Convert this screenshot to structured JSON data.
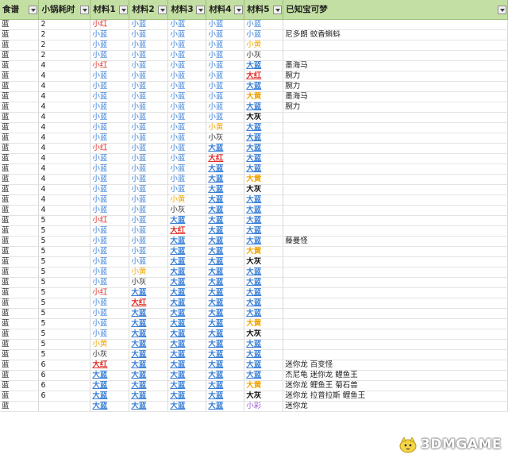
{
  "headers": [
    "食谱",
    "小锅耗时",
    "材料1",
    "材料2",
    "材料3",
    "材料4",
    "材料5",
    "已知宝可梦"
  ],
  "filtered_columns": [
    0,
    1,
    2,
    3,
    4,
    5,
    6,
    7
  ],
  "row_numbers": [
    "2",
    "3",
    "3",
    "3",
    "3",
    "8",
    "8",
    "9",
    "0",
    "1",
    "3",
    "7",
    "7",
    "8",
    "9",
    "0",
    "3",
    "4",
    "2",
    "4",
    "6",
    "2",
    "2",
    "8",
    "2",
    "0",
    "3",
    "4",
    "8",
    "2",
    "3",
    "2",
    "3",
    "4",
    "5",
    "8",
    "3",
    "8",
    "2",
    "4",
    "5",
    "5"
  ],
  "rows": [
    {
      "recipe": "蓝",
      "time": "2",
      "m1": "小红",
      "m1c": "red",
      "m2": "小蓝",
      "m2c": "blue",
      "m3": "小蓝",
      "m3c": "blue",
      "m4": "小蓝",
      "m4c": "blue",
      "m5": "小蓝",
      "m5c": "blue",
      "mons": ""
    },
    {
      "recipe": "蓝",
      "time": "2",
      "m1": "小蓝",
      "m1c": "blue",
      "m2": "小蓝",
      "m2c": "blue",
      "m3": "小蓝",
      "m3c": "blue",
      "m4": "小蓝",
      "m4c": "blue",
      "m5": "小蓝",
      "m5c": "blue",
      "mons": "尼多朗 蚊香蝌蚪"
    },
    {
      "recipe": "蓝",
      "time": "2",
      "m1": "小蓝",
      "m1c": "blue",
      "m2": "小蓝",
      "m2c": "blue",
      "m3": "小蓝",
      "m3c": "blue",
      "m4": "小蓝",
      "m4c": "blue",
      "m5": "小黄",
      "m5c": "yellow",
      "mons": ""
    },
    {
      "recipe": "蓝",
      "time": "2",
      "m1": "小蓝",
      "m1c": "blue",
      "m2": "小蓝",
      "m2c": "blue",
      "m3": "小蓝",
      "m3c": "blue",
      "m4": "小蓝",
      "m4c": "blue",
      "m5": "小灰",
      "m5c": "gray",
      "mons": ""
    },
    {
      "recipe": "蓝",
      "time": "4",
      "m1": "小红",
      "m1c": "red",
      "m2": "小蓝",
      "m2c": "blue",
      "m3": "小蓝",
      "m3c": "blue",
      "m4": "小蓝",
      "m4c": "blue",
      "m5": "大蓝",
      "m5c": "blue",
      "m5b": true,
      "mons": "墨海马"
    },
    {
      "recipe": "蓝",
      "time": "4",
      "m1": "小蓝",
      "m1c": "blue",
      "m2": "小蓝",
      "m2c": "blue",
      "m3": "小蓝",
      "m3c": "blue",
      "m4": "小蓝",
      "m4c": "blue",
      "m5": "大红",
      "m5c": "red",
      "m5b": true,
      "mons": "腕力"
    },
    {
      "recipe": "蓝",
      "time": "4",
      "m1": "小蓝",
      "m1c": "blue",
      "m2": "小蓝",
      "m2c": "blue",
      "m3": "小蓝",
      "m3c": "blue",
      "m4": "小蓝",
      "m4c": "blue",
      "m5": "大蓝",
      "m5c": "blue",
      "m5b": true,
      "mons": "腕力"
    },
    {
      "recipe": "蓝",
      "time": "4",
      "m1": "小蓝",
      "m1c": "blue",
      "m2": "小蓝",
      "m2c": "blue",
      "m3": "小蓝",
      "m3c": "blue",
      "m4": "小蓝",
      "m4c": "blue",
      "m5": "大黄",
      "m5c": "yellow",
      "m5b": true,
      "mons": "墨海马"
    },
    {
      "recipe": "蓝",
      "time": "4",
      "m1": "小蓝",
      "m1c": "blue",
      "m2": "小蓝",
      "m2c": "blue",
      "m3": "小蓝",
      "m3c": "blue",
      "m4": "小蓝",
      "m4c": "blue",
      "m5": "大蓝",
      "m5c": "blue",
      "m5b": true,
      "mons": "腕力"
    },
    {
      "recipe": "蓝",
      "time": "4",
      "m1": "小蓝",
      "m1c": "blue",
      "m2": "小蓝",
      "m2c": "blue",
      "m3": "小蓝",
      "m3c": "blue",
      "m4": "小蓝",
      "m4c": "blue",
      "m5": "大灰",
      "m5c": "gray",
      "m5b": true,
      "mons": ""
    },
    {
      "recipe": "蓝",
      "time": "4",
      "m1": "小蓝",
      "m1c": "blue",
      "m2": "小蓝",
      "m2c": "blue",
      "m3": "小蓝",
      "m3c": "blue",
      "m4": "小黄",
      "m4c": "yellow",
      "m5": "大蓝",
      "m5c": "blue",
      "m5b": true,
      "mons": ""
    },
    {
      "recipe": "蓝",
      "time": "4",
      "m1": "小蓝",
      "m1c": "blue",
      "m2": "小蓝",
      "m2c": "blue",
      "m3": "小蓝",
      "m3c": "blue",
      "m4": "小灰",
      "m4c": "gray",
      "m5": "大蓝",
      "m5c": "blue",
      "m5b": true,
      "mons": ""
    },
    {
      "recipe": "蓝",
      "time": "4",
      "m1": "小红",
      "m1c": "red",
      "m2": "小蓝",
      "m2c": "blue",
      "m3": "小蓝",
      "m3c": "blue",
      "m4": "大蓝",
      "m4c": "blue",
      "m4b": true,
      "m5": "大蓝",
      "m5c": "blue",
      "m5b": true,
      "mons": ""
    },
    {
      "recipe": "蓝",
      "time": "4",
      "m1": "小蓝",
      "m1c": "blue",
      "m2": "小蓝",
      "m2c": "blue",
      "m3": "小蓝",
      "m3c": "blue",
      "m4": "大红",
      "m4c": "red",
      "m4b": true,
      "m5": "大蓝",
      "m5c": "blue",
      "m5b": true,
      "mons": ""
    },
    {
      "recipe": "蓝",
      "time": "4",
      "m1": "小蓝",
      "m1c": "blue",
      "m2": "小蓝",
      "m2c": "blue",
      "m3": "小蓝",
      "m3c": "blue",
      "m4": "大蓝",
      "m4c": "blue",
      "m4b": true,
      "m5": "大蓝",
      "m5c": "blue",
      "m5b": true,
      "mons": ""
    },
    {
      "recipe": "蓝",
      "time": "4",
      "m1": "小蓝",
      "m1c": "blue",
      "m2": "小蓝",
      "m2c": "blue",
      "m3": "小蓝",
      "m3c": "blue",
      "m4": "大蓝",
      "m4c": "blue",
      "m4b": true,
      "m5": "大黄",
      "m5c": "yellow",
      "m5b": true,
      "mons": ""
    },
    {
      "recipe": "蓝",
      "time": "4",
      "m1": "小蓝",
      "m1c": "blue",
      "m2": "小蓝",
      "m2c": "blue",
      "m3": "小蓝",
      "m3c": "blue",
      "m4": "大蓝",
      "m4c": "blue",
      "m4b": true,
      "m5": "大灰",
      "m5c": "gray",
      "m5b": true,
      "mons": ""
    },
    {
      "recipe": "蓝",
      "time": "4",
      "m1": "小蓝",
      "m1c": "blue",
      "m2": "小蓝",
      "m2c": "blue",
      "m3": "小黄",
      "m3c": "yellow",
      "m4": "大蓝",
      "m4c": "blue",
      "m4b": true,
      "m5": "大蓝",
      "m5c": "blue",
      "m5b": true,
      "mons": ""
    },
    {
      "recipe": "蓝",
      "time": "4",
      "m1": "小蓝",
      "m1c": "blue",
      "m2": "小蓝",
      "m2c": "blue",
      "m3": "小灰",
      "m3c": "gray",
      "m4": "大蓝",
      "m4c": "blue",
      "m4b": true,
      "m5": "大蓝",
      "m5c": "blue",
      "m5b": true,
      "mons": ""
    },
    {
      "recipe": "蓝",
      "time": "5",
      "m1": "小红",
      "m1c": "red",
      "m2": "小蓝",
      "m2c": "blue",
      "m3": "大蓝",
      "m3c": "blue",
      "m3b": true,
      "m4": "大蓝",
      "m4c": "blue",
      "m4b": true,
      "m5": "大蓝",
      "m5c": "blue",
      "m5b": true,
      "mons": ""
    },
    {
      "recipe": "蓝",
      "time": "5",
      "m1": "小蓝",
      "m1c": "blue",
      "m2": "小蓝",
      "m2c": "blue",
      "m3": "大红",
      "m3c": "red",
      "m3b": true,
      "m4": "大蓝",
      "m4c": "blue",
      "m4b": true,
      "m5": "大蓝",
      "m5c": "blue",
      "m5b": true,
      "mons": ""
    },
    {
      "recipe": "蓝",
      "time": "5",
      "m1": "小蓝",
      "m1c": "blue",
      "m2": "小蓝",
      "m2c": "blue",
      "m3": "大蓝",
      "m3c": "blue",
      "m3b": true,
      "m4": "大蓝",
      "m4c": "blue",
      "m4b": true,
      "m5": "大蓝",
      "m5c": "blue",
      "m5b": true,
      "mons": "藤曼怪"
    },
    {
      "recipe": "蓝",
      "time": "5",
      "m1": "小蓝",
      "m1c": "blue",
      "m2": "小蓝",
      "m2c": "blue",
      "m3": "大蓝",
      "m3c": "blue",
      "m3b": true,
      "m4": "大蓝",
      "m4c": "blue",
      "m4b": true,
      "m5": "大黄",
      "m5c": "yellow",
      "m5b": true,
      "mons": ""
    },
    {
      "recipe": "蓝",
      "time": "5",
      "m1": "小蓝",
      "m1c": "blue",
      "m2": "小蓝",
      "m2c": "blue",
      "m3": "大蓝",
      "m3c": "blue",
      "m3b": true,
      "m4": "大蓝",
      "m4c": "blue",
      "m4b": true,
      "m5": "大灰",
      "m5c": "gray",
      "m5b": true,
      "mons": ""
    },
    {
      "recipe": "蓝",
      "time": "5",
      "m1": "小蓝",
      "m1c": "blue",
      "m2": "小黄",
      "m2c": "yellow",
      "m3": "大蓝",
      "m3c": "blue",
      "m3b": true,
      "m4": "大蓝",
      "m4c": "blue",
      "m4b": true,
      "m5": "大蓝",
      "m5c": "blue",
      "m5b": true,
      "mons": ""
    },
    {
      "recipe": "蓝",
      "time": "5",
      "m1": "小蓝",
      "m1c": "blue",
      "m2": "小灰",
      "m2c": "gray",
      "m3": "大蓝",
      "m3c": "blue",
      "m3b": true,
      "m4": "大蓝",
      "m4c": "blue",
      "m4b": true,
      "m5": "大蓝",
      "m5c": "blue",
      "m5b": true,
      "mons": ""
    },
    {
      "recipe": "蓝",
      "time": "5",
      "m1": "小红",
      "m1c": "red",
      "m2": "大蓝",
      "m2c": "blue",
      "m2b": true,
      "m3": "大蓝",
      "m3c": "blue",
      "m3b": true,
      "m4": "大蓝",
      "m4c": "blue",
      "m4b": true,
      "m5": "大蓝",
      "m5c": "blue",
      "m5b": true,
      "mons": ""
    },
    {
      "recipe": "蓝",
      "time": "5",
      "m1": "小蓝",
      "m1c": "blue",
      "m2": "大红",
      "m2c": "red",
      "m2b": true,
      "m3": "大蓝",
      "m3c": "blue",
      "m3b": true,
      "m4": "大蓝",
      "m4c": "blue",
      "m4b": true,
      "m5": "大蓝",
      "m5c": "blue",
      "m5b": true,
      "mons": ""
    },
    {
      "recipe": "蓝",
      "time": "5",
      "m1": "小蓝",
      "m1c": "blue",
      "m2": "大蓝",
      "m2c": "blue",
      "m2b": true,
      "m3": "大蓝",
      "m3c": "blue",
      "m3b": true,
      "m4": "大蓝",
      "m4c": "blue",
      "m4b": true,
      "m5": "大蓝",
      "m5c": "blue",
      "m5b": true,
      "mons": ""
    },
    {
      "recipe": "蓝",
      "time": "5",
      "m1": "小蓝",
      "m1c": "blue",
      "m2": "大蓝",
      "m2c": "blue",
      "m2b": true,
      "m3": "大蓝",
      "m3c": "blue",
      "m3b": true,
      "m4": "大蓝",
      "m4c": "blue",
      "m4b": true,
      "m5": "大黄",
      "m5c": "yellow",
      "m5b": true,
      "mons": ""
    },
    {
      "recipe": "蓝",
      "time": "5",
      "m1": "小蓝",
      "m1c": "blue",
      "m2": "大蓝",
      "m2c": "blue",
      "m2b": true,
      "m3": "大蓝",
      "m3c": "blue",
      "m3b": true,
      "m4": "大蓝",
      "m4c": "blue",
      "m4b": true,
      "m5": "大灰",
      "m5c": "gray",
      "m5b": true,
      "mons": ""
    },
    {
      "recipe": "蓝",
      "time": "5",
      "m1": "小黄",
      "m1c": "yellow",
      "m2": "大蓝",
      "m2c": "blue",
      "m2b": true,
      "m3": "大蓝",
      "m3c": "blue",
      "m3b": true,
      "m4": "大蓝",
      "m4c": "blue",
      "m4b": true,
      "m5": "大蓝",
      "m5c": "blue",
      "m5b": true,
      "mons": ""
    },
    {
      "recipe": "蓝",
      "time": "5",
      "m1": "小灰",
      "m1c": "gray",
      "m2": "大蓝",
      "m2c": "blue",
      "m2b": true,
      "m3": "大蓝",
      "m3c": "blue",
      "m3b": true,
      "m4": "大蓝",
      "m4c": "blue",
      "m4b": true,
      "m5": "大蓝",
      "m5c": "blue",
      "m5b": true,
      "mons": ""
    },
    {
      "recipe": "蓝",
      "time": "6",
      "m1": "大红",
      "m1c": "red",
      "m1b": true,
      "m2": "大蓝",
      "m2c": "blue",
      "m2b": true,
      "m3": "大蓝",
      "m3c": "blue",
      "m3b": true,
      "m4": "大蓝",
      "m4c": "blue",
      "m4b": true,
      "m5": "大蓝",
      "m5c": "blue",
      "m5b": true,
      "mons": "迷你龙 百变怪"
    },
    {
      "recipe": "蓝",
      "time": "6",
      "m1": "大蓝",
      "m1c": "blue",
      "m1b": true,
      "m2": "大蓝",
      "m2c": "blue",
      "m2b": true,
      "m3": "大蓝",
      "m3c": "blue",
      "m3b": true,
      "m4": "大蓝",
      "m4c": "blue",
      "m4b": true,
      "m5": "大蓝",
      "m5c": "blue",
      "m5b": true,
      "mons": "杰尼龟 迷你龙 鲤鱼王"
    },
    {
      "recipe": "蓝",
      "time": "6",
      "m1": "大蓝",
      "m1c": "blue",
      "m1b": true,
      "m2": "大蓝",
      "m2c": "blue",
      "m2b": true,
      "m3": "大蓝",
      "m3c": "blue",
      "m3b": true,
      "m4": "大蓝",
      "m4c": "blue",
      "m4b": true,
      "m5": "大黄",
      "m5c": "yellow",
      "m5b": true,
      "mons": "迷你龙 鲤鱼王 菊石兽"
    },
    {
      "recipe": "蓝",
      "time": "6",
      "m1": "大蓝",
      "m1c": "blue",
      "m1b": true,
      "m2": "大蓝",
      "m2c": "blue",
      "m2b": true,
      "m3": "大蓝",
      "m3c": "blue",
      "m3b": true,
      "m4": "大蓝",
      "m4c": "blue",
      "m4b": true,
      "m5": "大灰",
      "m5c": "gray",
      "m5b": true,
      "mons": "迷你龙 拉普拉斯 鲤鱼王"
    },
    {
      "recipe": "蓝",
      "time": "",
      "m1": "大蓝",
      "m1c": "blue",
      "m1b": true,
      "m2": "大蓝",
      "m2c": "blue",
      "m2b": true,
      "m3": "大蓝",
      "m3c": "blue",
      "m3b": true,
      "m4": "大蓝",
      "m4c": "blue",
      "m4b": true,
      "m5": "小彩",
      "m5c": "purple",
      "mons": "迷你龙"
    }
  ],
  "watermark": "3DMGAME"
}
